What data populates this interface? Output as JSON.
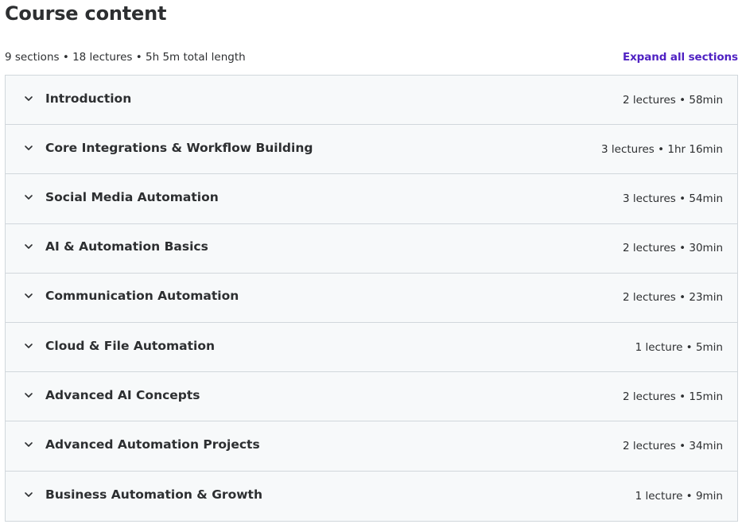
{
  "header": {
    "title": "Course content",
    "summary": "9 sections • 18 lectures • 5h 5m total length",
    "expand_label": "Expand all sections"
  },
  "colors": {
    "accent": "#5022c3",
    "section_bg": "#f7f9fa",
    "border": "#d1d7dc",
    "text": "#2d2f31"
  },
  "sections": [
    {
      "title": "Introduction",
      "meta": "2 lectures • 58min"
    },
    {
      "title": "Core Integrations & Workflow Building",
      "meta": "3 lectures • 1hr 16min"
    },
    {
      "title": "Social Media Automation",
      "meta": "3 lectures • 54min"
    },
    {
      "title": "AI & Automation Basics",
      "meta": "2 lectures • 30min"
    },
    {
      "title": "Communication Automation",
      "meta": "2 lectures • 23min"
    },
    {
      "title": "Cloud & File Automation",
      "meta": "1 lecture • 5min"
    },
    {
      "title": "Advanced AI Concepts",
      "meta": "2 lectures • 15min"
    },
    {
      "title": "Advanced Automation Projects",
      "meta": "2 lectures • 34min"
    },
    {
      "title": "Business Automation & Growth",
      "meta": "1 lecture • 9min"
    }
  ]
}
